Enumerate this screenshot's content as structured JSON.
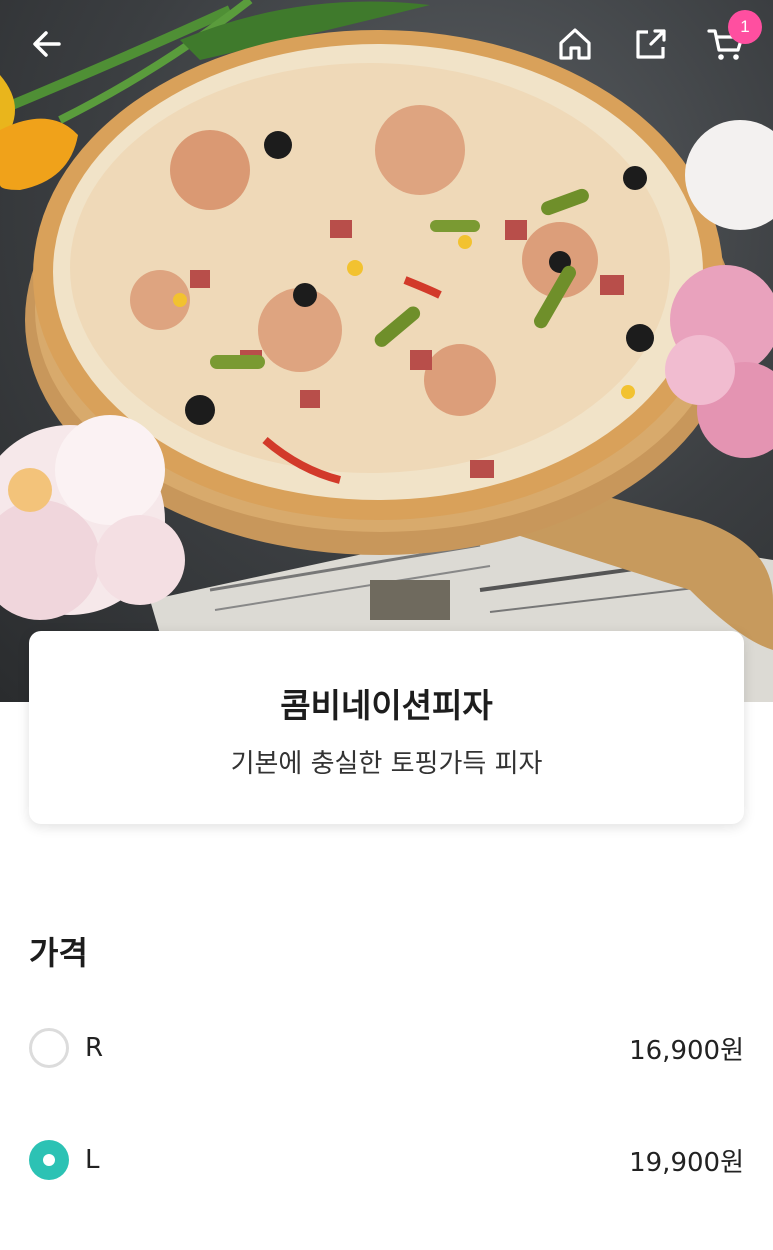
{
  "header": {
    "back_icon": "back-arrow-icon",
    "home_icon": "home-icon",
    "share_icon": "share-icon",
    "cart_icon": "cart-icon",
    "cart_count": "1",
    "cart_badge_color": "#ff4fa0"
  },
  "product": {
    "name": "콤비네이션피자",
    "description": "기본에 충실한 토핑가득 피자"
  },
  "price_section": {
    "title": "가격",
    "options": [
      {
        "label": "R",
        "price": "16,900원",
        "selected": false
      },
      {
        "label": "L",
        "price": "19,900원",
        "selected": true
      }
    ],
    "accent_color": "#2cc2b4"
  }
}
